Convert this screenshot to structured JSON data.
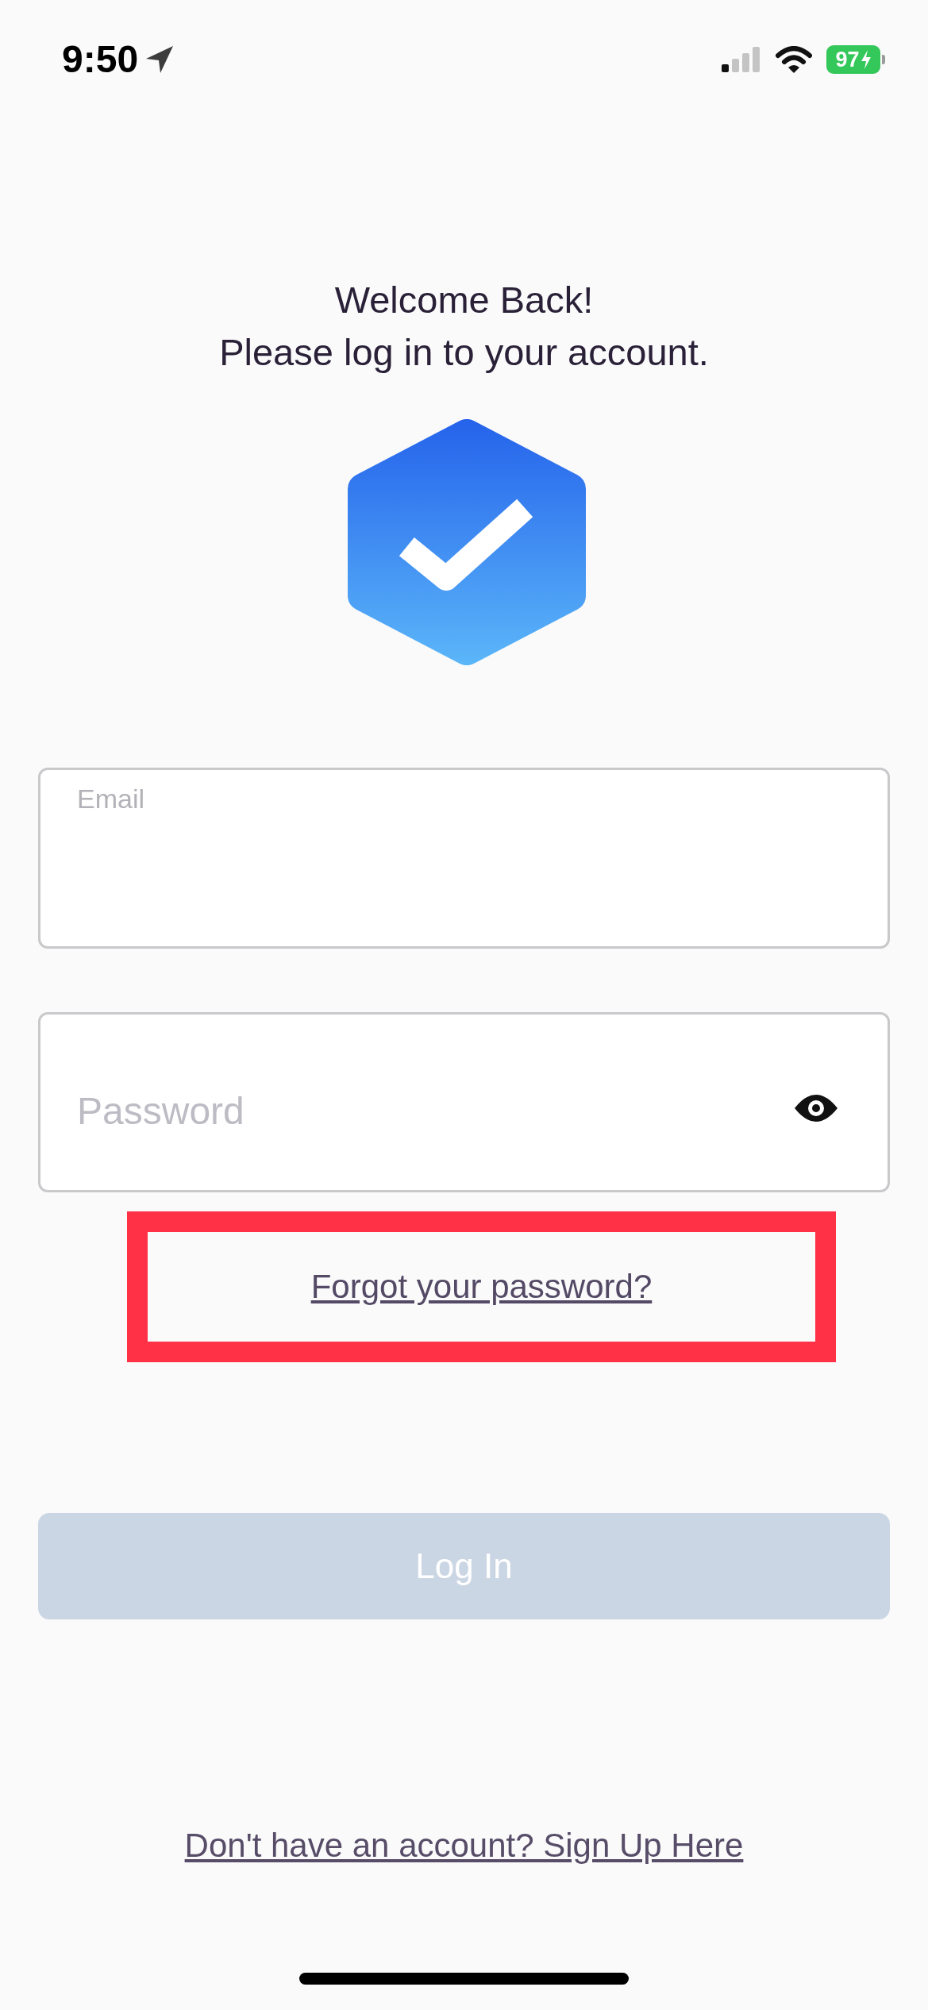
{
  "status_bar": {
    "time": "9:50",
    "battery": "97",
    "charging": true
  },
  "header": {
    "title": "Welcome Back!",
    "subtitle": "Please log in to your account."
  },
  "form": {
    "email": {
      "label": "Email"
    },
    "password": {
      "placeholder": "Password"
    },
    "forgot_password": {
      "label": "Forgot your password?",
      "highlighted": true
    },
    "login_button": {
      "label": "Log In",
      "disabled": true
    }
  },
  "sign_up_link": "Don't have an account? Sign Up Here"
}
